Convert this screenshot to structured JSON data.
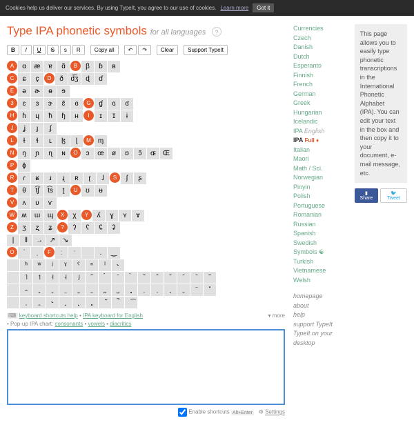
{
  "cookie": {
    "text": "Cookies help us deliver our services. By using TypeIt, you agree to our use of cookies.",
    "learn": "Learn more",
    "got": "Got it"
  },
  "title": "Type IPA phonetic symbols",
  "subtitle": "for all languages",
  "qmark": "?",
  "toolbar": {
    "b": "B",
    "i": "I",
    "u": "U",
    "s": "S",
    "small_s": "s",
    "r": "R",
    "copy": "Copy all",
    "undo": "↶",
    "redo": "↷",
    "clear": "Clear",
    "support": "Support TypeIt"
  },
  "rows": [
    [
      "A",
      "ɑ",
      "æ",
      "ɐ",
      "ɑ̃",
      "B",
      "β",
      "ɓ",
      "ʙ"
    ],
    [
      "C",
      "ɕ",
      "ç",
      "D",
      "ð",
      "d͡ʒ",
      "ɖ",
      "ɗ"
    ],
    [
      "E",
      "ə",
      "ɚ",
      "ɵ",
      "ɘ"
    ],
    [
      "3",
      "ɛ",
      "ɜ",
      "ɝ",
      "ɛ̃",
      "ɞ",
      "G",
      "ɠ",
      "ɢ",
      "ʛ"
    ],
    [
      "H",
      "ɦ",
      "ɥ",
      "ħ",
      "ɧ",
      "ʜ",
      "I",
      "ɪ",
      "ɪ̈",
      "ɨ"
    ],
    [
      "J",
      "ʝ",
      "ɟ",
      "ʄ"
    ],
    [
      "L",
      "ɫ",
      "ɬ",
      "ʟ",
      "ɮ",
      "ɭ",
      "M",
      "ɱ"
    ],
    [
      "N",
      "ŋ",
      "ɲ",
      "ɳ",
      "ɴ",
      "O",
      "ɔ",
      "œ",
      "ø",
      "ɒ",
      "ɔ̃",
      "ɶ",
      "Œ"
    ],
    [
      "P",
      "ɸ"
    ],
    [
      "R",
      "ɾ",
      "ʁ",
      "ɹ",
      "ɻ",
      "ʀ",
      "ɽ",
      "ɺ",
      "S",
      "ʃ",
      "ʂ"
    ],
    [
      "T",
      "θ",
      "t͡ʃ",
      "t͡s",
      "ʈ",
      "U",
      "ʊ",
      "ʉ"
    ],
    [
      "V",
      "ʌ",
      "ʋ",
      "ѵ"
    ],
    [
      "W",
      "ʍ",
      "ɯ",
      "ɰ",
      "X",
      "χ",
      "Y",
      "ʎ",
      "ɣ",
      "ʏ",
      "ɤ"
    ],
    [
      "Z",
      "ʒ",
      "ʐ",
      "ʑ",
      "?",
      "ʔ",
      "ʕ",
      "ʢ",
      "ʡ"
    ],
    [
      "|",
      "‖",
      "→",
      "↗",
      "↘"
    ],
    [
      "O",
      "ˈ",
      "ˌ",
      "F",
      "ː",
      "ˑ",
      "",
      ".",
      "‿"
    ],
    [
      "",
      "ʰ",
      "ʷ",
      "ʲ",
      "ˠ",
      "ˤ",
      "ⁿ",
      "ˡ",
      "˞"
    ],
    [
      "",
      "˥",
      "˦",
      "˧",
      "˨",
      "˩",
      "̋",
      "́",
      "̄",
      "̀",
      "̏",
      "̂",
      "̌",
      "᷄",
      "᷅",
      "᷈"
    ],
    [
      "",
      "̴",
      "̥",
      "̬",
      "̤",
      "̰",
      "̼",
      "̪",
      "̺",
      "̻",
      "̹",
      "̜",
      "̟",
      "̠",
      "̈",
      "̽"
    ],
    [
      "",
      "̩",
      "̯",
      "˞",
      "̘",
      "̙",
      "̻",
      "̃",
      "̚",
      "͡"
    ]
  ],
  "hints": {
    "l1a": "keyboard shortcuts help",
    "l1b": "IPA keyboard for English",
    "l2": "• Pop-up IPA chart:",
    "c": "consonants",
    "v": "vowels",
    "d": "diacritics",
    "more": "▾ more"
  },
  "footer": {
    "enable": "Enable shortcuts",
    "alt": "Alt+Enter",
    "settings": "Settings"
  },
  "langs": [
    "Currencies",
    "Czech",
    "Danish",
    "Dutch",
    "Esperanto",
    "Finnish",
    "French",
    "German",
    "Greek",
    "Hungarian",
    "Icelandic",
    "IPA English",
    "IPA Full ♦",
    "Italian",
    "Maori",
    "Math / Sci.",
    "Norwegian",
    "Pinyin",
    "Polish",
    "Portuguese",
    "Romanian",
    "Russian",
    "Spanish",
    "Swedish",
    "Symbols ☯",
    "Turkish",
    "Vietnamese",
    "Welsh"
  ],
  "nav": [
    "homepage",
    "about",
    "help",
    "support TypeIt",
    "TypeIt on your desktop"
  ],
  "about": "This page allows you to easily type phonetic transcriptions in the International Phonetic Alphabet (IPA). You can edit your text in the box and then copy it to your document, e-mail message, etc.",
  "social": {
    "share": "Share",
    "tweet": "Tweet"
  }
}
